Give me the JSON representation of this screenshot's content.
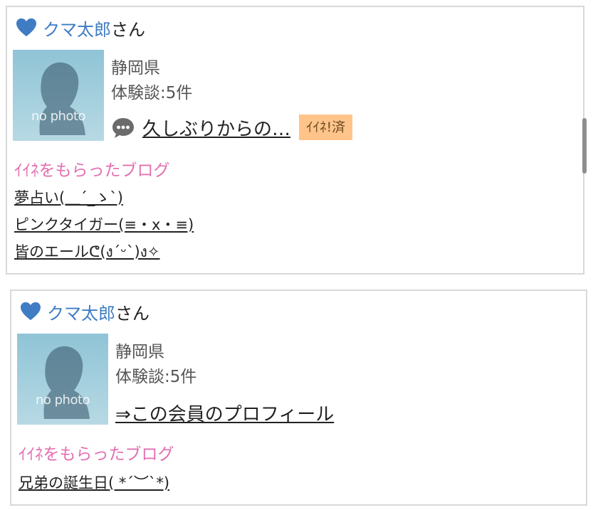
{
  "cards": [
    {
      "user_name": "クマ太郎",
      "honorific": "さん",
      "photo_placeholder": "no photo",
      "prefecture": "静岡県",
      "experience_count": "体験談:5件",
      "latest_blog_title": "久しぶりからの…",
      "iine_badge": "ｲｲﾈ!済",
      "section_title": "ｲｲﾈをもらったブログ",
      "liked_blogs": [
        "夢占い(＿´_ゝ`)",
        "ピンクタイガー(≡・x・≡)",
        "皆のエールᕦ(ง´ᵕ`)ง✧"
      ]
    },
    {
      "user_name": "クマ太郎",
      "honorific": "さん",
      "photo_placeholder": "no photo",
      "prefecture": "静岡県",
      "experience_count": "体験談:5件",
      "profile_link": "⇒この会員のプロフィール",
      "section_title": "ｲｲﾈをもらったブログ",
      "liked_blogs": [
        "兄弟の誕生日( *´︶`*)"
      ]
    }
  ],
  "colors": {
    "user_name": "#3f7cc4",
    "section_title": "#e36fb0",
    "iine_badge_bg": "#ffc48a",
    "heart": "#3f7cc4"
  },
  "icons": {
    "favorite": "heart-icon",
    "comment": "speech-bubble-icon"
  }
}
